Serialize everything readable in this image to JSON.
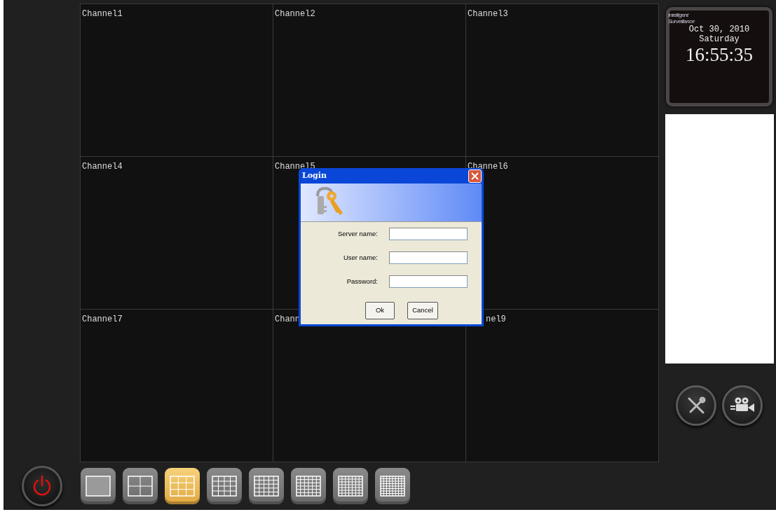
{
  "channels": [
    {
      "label": "Channel1"
    },
    {
      "label": "Channel2"
    },
    {
      "label": "Channel3"
    },
    {
      "label": "Channel4"
    },
    {
      "label": "Channel5"
    },
    {
      "label": "Channel6"
    },
    {
      "label": "Channel7"
    },
    {
      "label": "Chann"
    },
    {
      "label": "nel9",
      "partly_covered": true
    }
  ],
  "login_dialog": {
    "title": "Login",
    "fields": [
      {
        "label": "Server name:"
      },
      {
        "label": "User name:"
      },
      {
        "label": "Password:"
      }
    ],
    "buttons": [
      "Ok",
      "Cancel"
    ]
  },
  "clock": {
    "logo_lines": [
      "Intelligent",
      "Surveillance"
    ],
    "date": "Oct 30, 2010",
    "day": "Saturday",
    "time": "16:55:35"
  },
  "layouts": [
    {
      "selected": false
    },
    {
      "selected": false
    },
    {
      "selected": true
    },
    {
      "selected": false
    },
    {
      "selected": false
    },
    {
      "selected": false
    },
    {
      "selected": false
    },
    {
      "selected": false
    }
  ]
}
